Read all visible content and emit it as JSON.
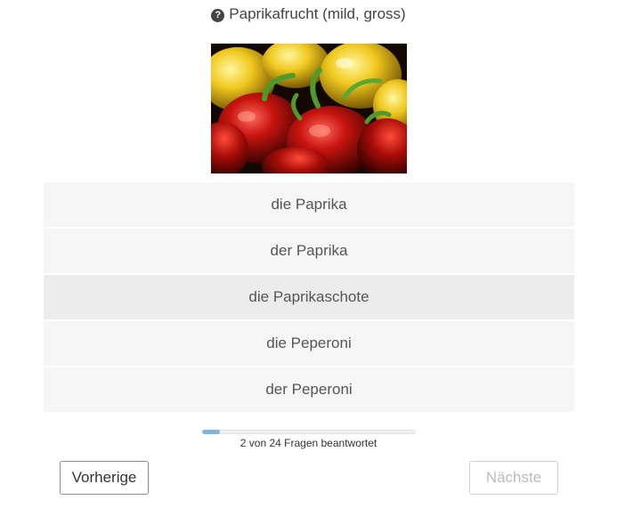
{
  "question": {
    "icon": "question-circle-icon",
    "text": "Paprikafrucht (mild, gross)"
  },
  "image": {
    "alt": "Paprika"
  },
  "answers": [
    {
      "label": "die Paprika"
    },
    {
      "label": "der Paprika"
    },
    {
      "label": "die Paprikaschote",
      "selected": true
    },
    {
      "label": "die Peperoni"
    },
    {
      "label": "der Peperoni"
    }
  ],
  "progress": {
    "answered": 2,
    "total": 24,
    "fraction": 0.083,
    "text": "2 von 24 Fragen beantwortet"
  },
  "buttons": {
    "previous": "Vorherige",
    "next": "Nächste"
  },
  "colors": {
    "answer_bg": "#f6f6f6",
    "answer_selected_bg": "#ececec",
    "progress_fill": "#7fb6df"
  }
}
